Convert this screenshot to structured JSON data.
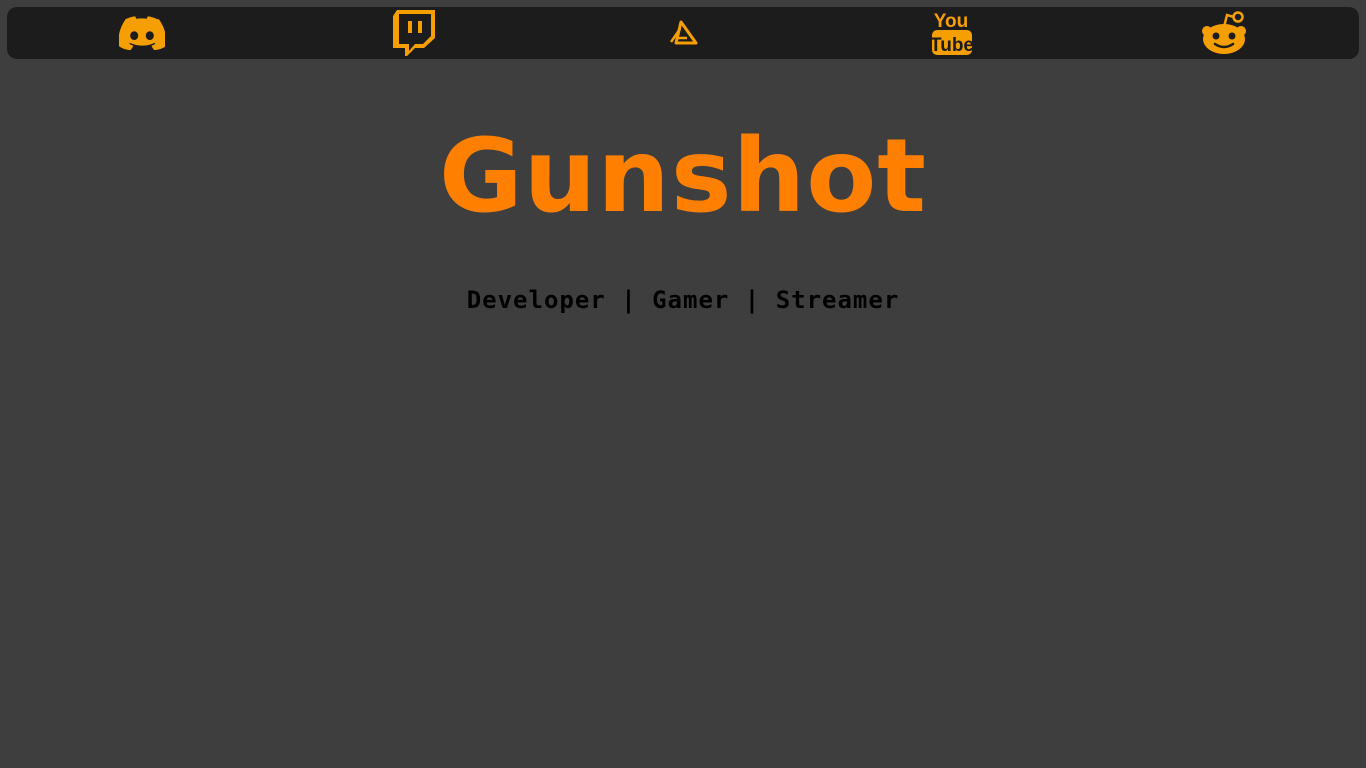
{
  "nav": {
    "items": [
      {
        "id": "discord",
        "icon": "discord-icon"
      },
      {
        "id": "twitch",
        "icon": "twitch-icon"
      },
      {
        "id": "artstation",
        "icon": "artstation-icon"
      },
      {
        "id": "youtube",
        "icon": "youtube-icon",
        "logo_text_top": "You",
        "logo_text_bottom": "Tube"
      },
      {
        "id": "reddit",
        "icon": "reddit-icon"
      }
    ]
  },
  "hero": {
    "title": "Gunshot",
    "tagline": "Developer | Gamer | Streamer"
  },
  "colors": {
    "background": "#3e3e3e",
    "navbar": "#1c1c1c",
    "accent": "#ff8000",
    "icon": "#f5a000",
    "tagline": "#000000"
  }
}
